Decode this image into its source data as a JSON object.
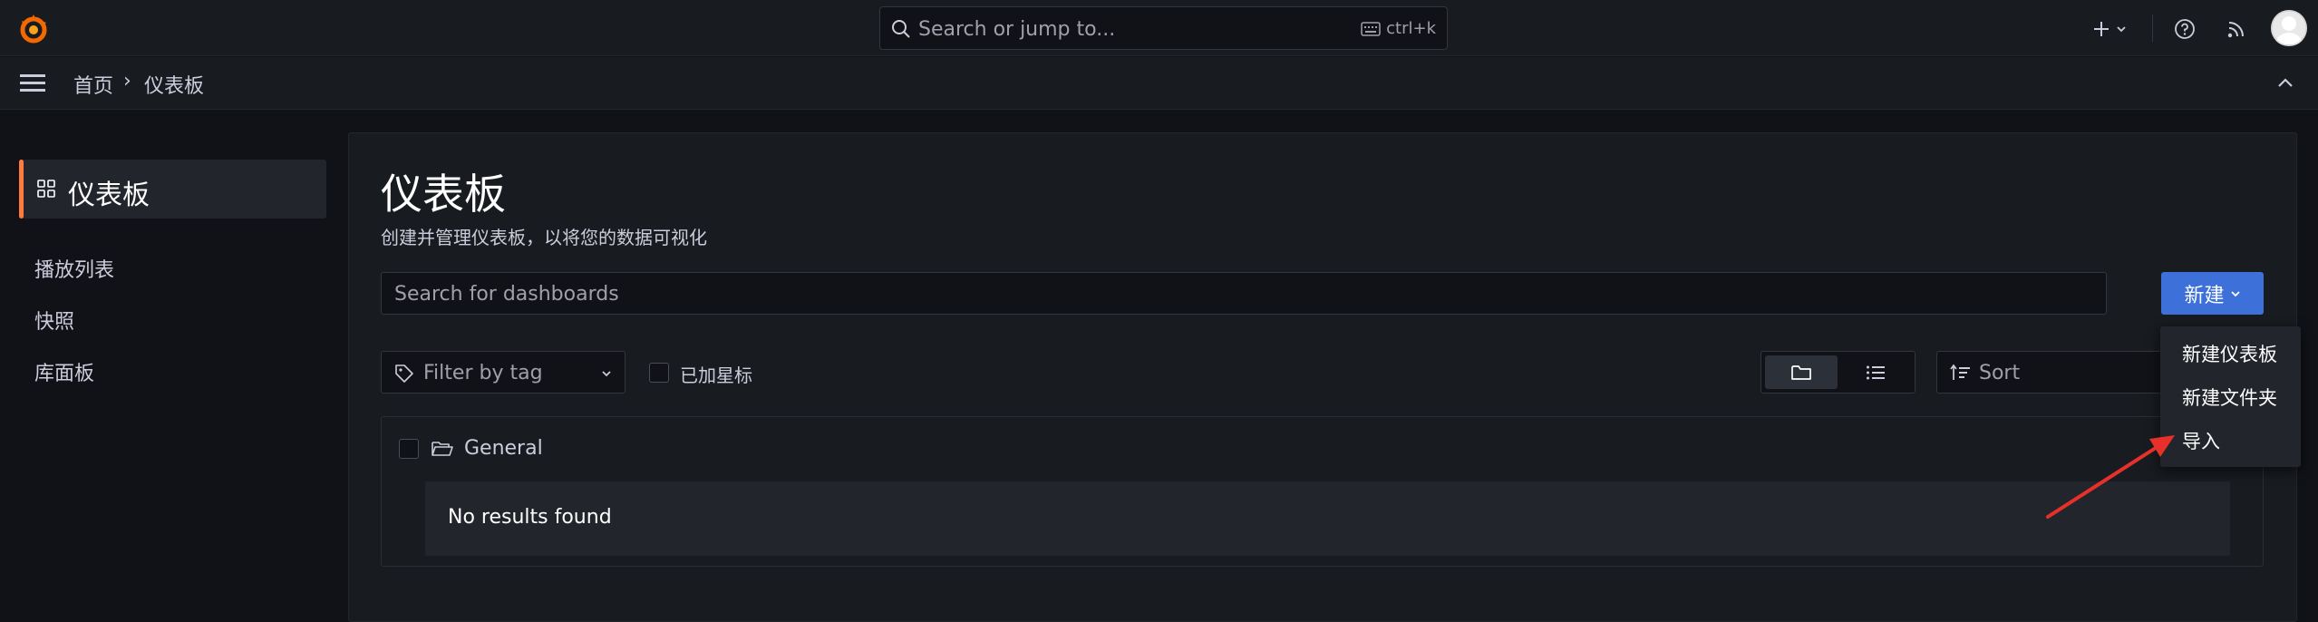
{
  "topbar": {
    "search_placeholder": "Search or jump to...",
    "shortcut": "ctrl+k"
  },
  "breadcrumb": {
    "home": "首页",
    "separator": "›",
    "current": "仪表板"
  },
  "sidebar": {
    "active_label": "仪表板",
    "items": [
      {
        "label": "播放列表"
      },
      {
        "label": "快照"
      },
      {
        "label": "库面板"
      }
    ]
  },
  "main": {
    "title": "仪表板",
    "subtitle": "创建并管理仪表板，以将您的数据可视化",
    "search_placeholder": "Search for dashboards",
    "new_button": "新建",
    "filter_tag_placeholder": "Filter by tag",
    "starred_label": "已加星标",
    "sort_placeholder": "Sort",
    "folder_name": "General",
    "empty_text": "No results found"
  },
  "new_menu": {
    "items": [
      {
        "label": "新建仪表板"
      },
      {
        "label": "新建文件夹"
      },
      {
        "label": "导入"
      }
    ]
  },
  "colors": {
    "accent_orange": "#ff7a3d",
    "primary_blue": "#3d71d9",
    "annotation_red": "#e8302a"
  }
}
